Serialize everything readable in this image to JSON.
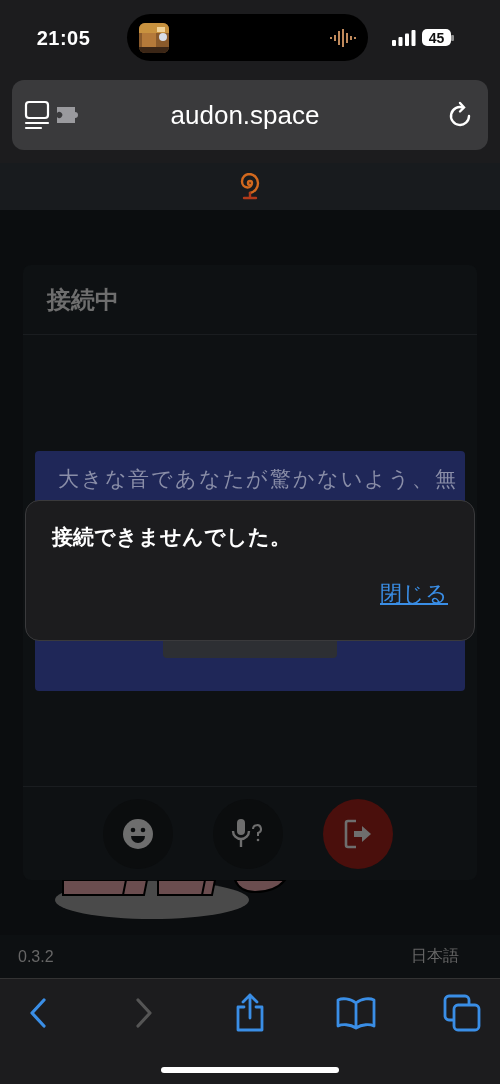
{
  "status_bar": {
    "time": "21:05",
    "battery": "45"
  },
  "address_bar": {
    "url": "audon.space"
  },
  "room": {
    "title": "接続中",
    "notice": {
      "text": "大きな音であなたが驚かないよう、無"
    },
    "controls": [
      {
        "kind": "emoji"
      },
      {
        "kind": "mic"
      },
      {
        "kind": "leave"
      }
    ]
  },
  "footer": {
    "version": "0.3.2",
    "language": "日本語"
  },
  "dialog": {
    "message": "接続できませんでした。",
    "close_link": "閉じる"
  },
  "toolbar": [
    {
      "kind": "back",
      "disabled": false
    },
    {
      "kind": "forward",
      "disabled": true
    },
    {
      "kind": "share",
      "disabled": false
    },
    {
      "kind": "bookmarks",
      "disabled": false
    },
    {
      "kind": "tabs",
      "disabled": false
    }
  ]
}
